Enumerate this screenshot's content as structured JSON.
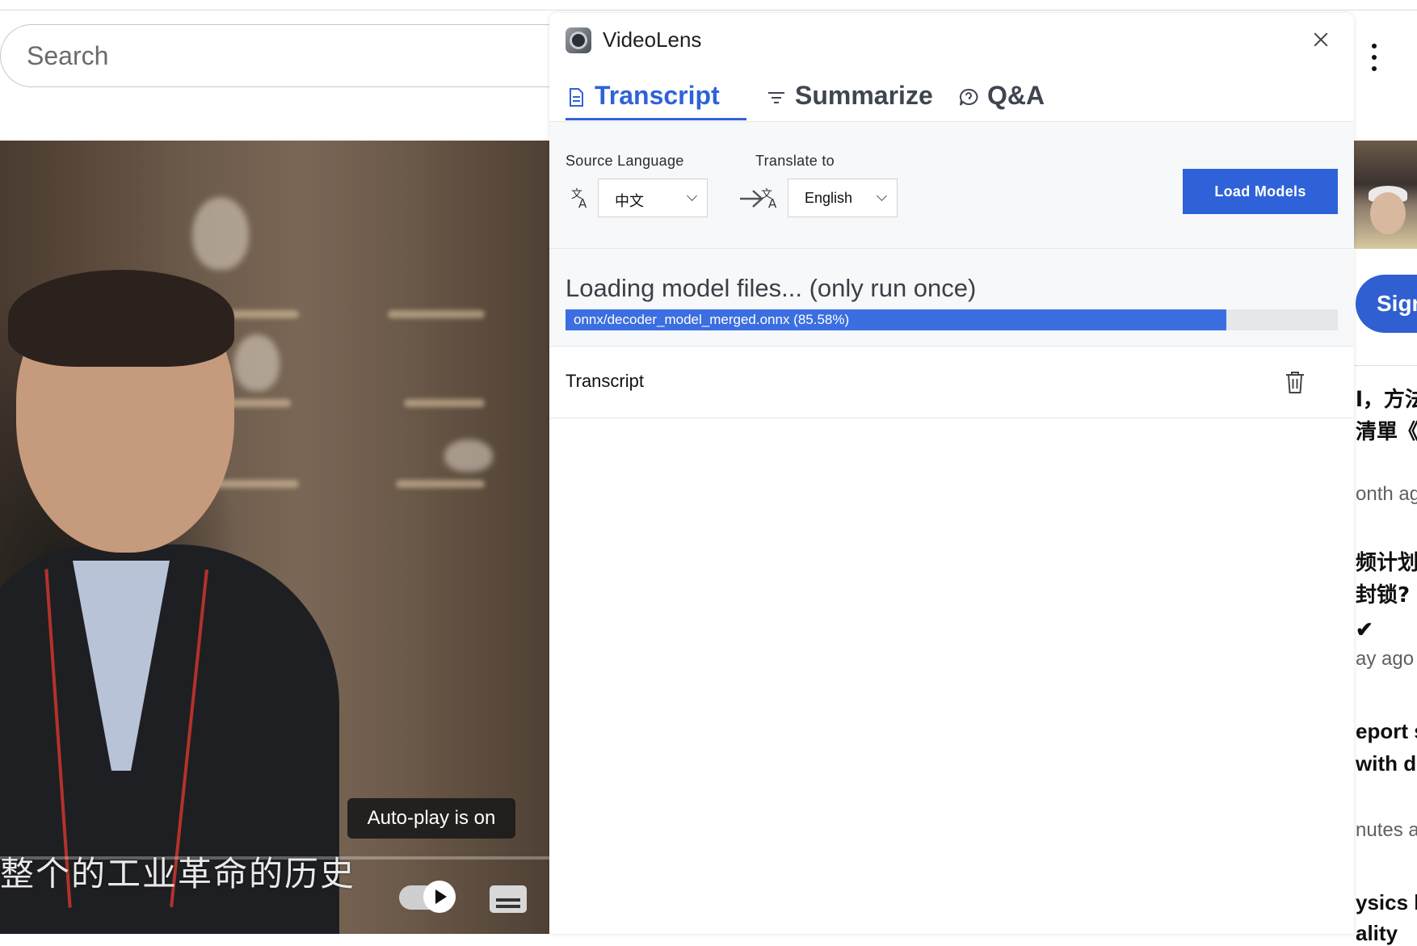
{
  "browser": {
    "search_placeholder": "Search"
  },
  "video": {
    "autoplay_tooltip": "Auto-play is on",
    "subtitle": "整个的工业革命的历史"
  },
  "sidebar": {
    "signin_label": "Sign",
    "items": [
      {
        "line1": "l，方法",
        "line2": "清單《努",
        "meta": "onth ag"
      },
      {
        "line1": "频计划",
        "line2": "封锁?",
        "meta": "ay ago"
      },
      {
        "line1": "eport s",
        "line2": "with dis",
        "meta": "nutes ag"
      },
      {
        "line1": "ysics l",
        "line2": "ality",
        "meta": ""
      }
    ]
  },
  "videolens": {
    "title": "VideoLens",
    "tabs": [
      {
        "label": "Transcript",
        "icon": "document-icon",
        "active": true
      },
      {
        "label": "Summarize",
        "icon": "filter-icon",
        "active": false
      },
      {
        "label": "Q&A",
        "icon": "chat-question-icon",
        "active": false
      }
    ],
    "source_language": {
      "label": "Source Language",
      "value": "中文"
    },
    "target_language": {
      "label": "Translate to",
      "value": "English"
    },
    "load_button": "Load Models",
    "loading": {
      "title": "Loading model files... (only run once)",
      "file_text": "onnx/decoder_model_merged.onnx (85.58%)",
      "progress_percent": 85.58
    },
    "transcript_section_title": "Transcript"
  },
  "colors": {
    "accent": "#2f62d9",
    "progress": "#3b6ee0",
    "tab_inactive": "#404552"
  }
}
